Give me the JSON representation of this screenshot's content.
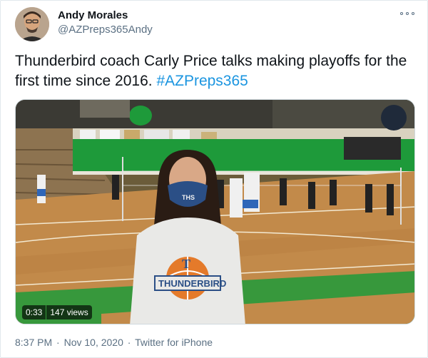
{
  "author": {
    "name": "Andy Morales",
    "handle": "@AZPreps365Andy"
  },
  "tweet": {
    "text": "Thunderbird coach Carly Price talks making playoffs for the first time since 2016.",
    "hashtag": "#AZPreps365"
  },
  "video": {
    "duration": "0:33",
    "views": "147 views",
    "shirt_text": "THUNDERBIRD",
    "shirt_letter": "T",
    "mask_text": "THS"
  },
  "meta": {
    "time": "8:37 PM",
    "date": "Nov 10, 2020",
    "separator": "·",
    "source": "Twitter for iPhone"
  },
  "colors": {
    "link": "#1b95e0",
    "secondary_text": "#5b7083",
    "gym_green": "#1e9a3a",
    "floor": "#c28a4a",
    "mask": "#2b4f86"
  },
  "icons": [
    "more-options-icon"
  ]
}
